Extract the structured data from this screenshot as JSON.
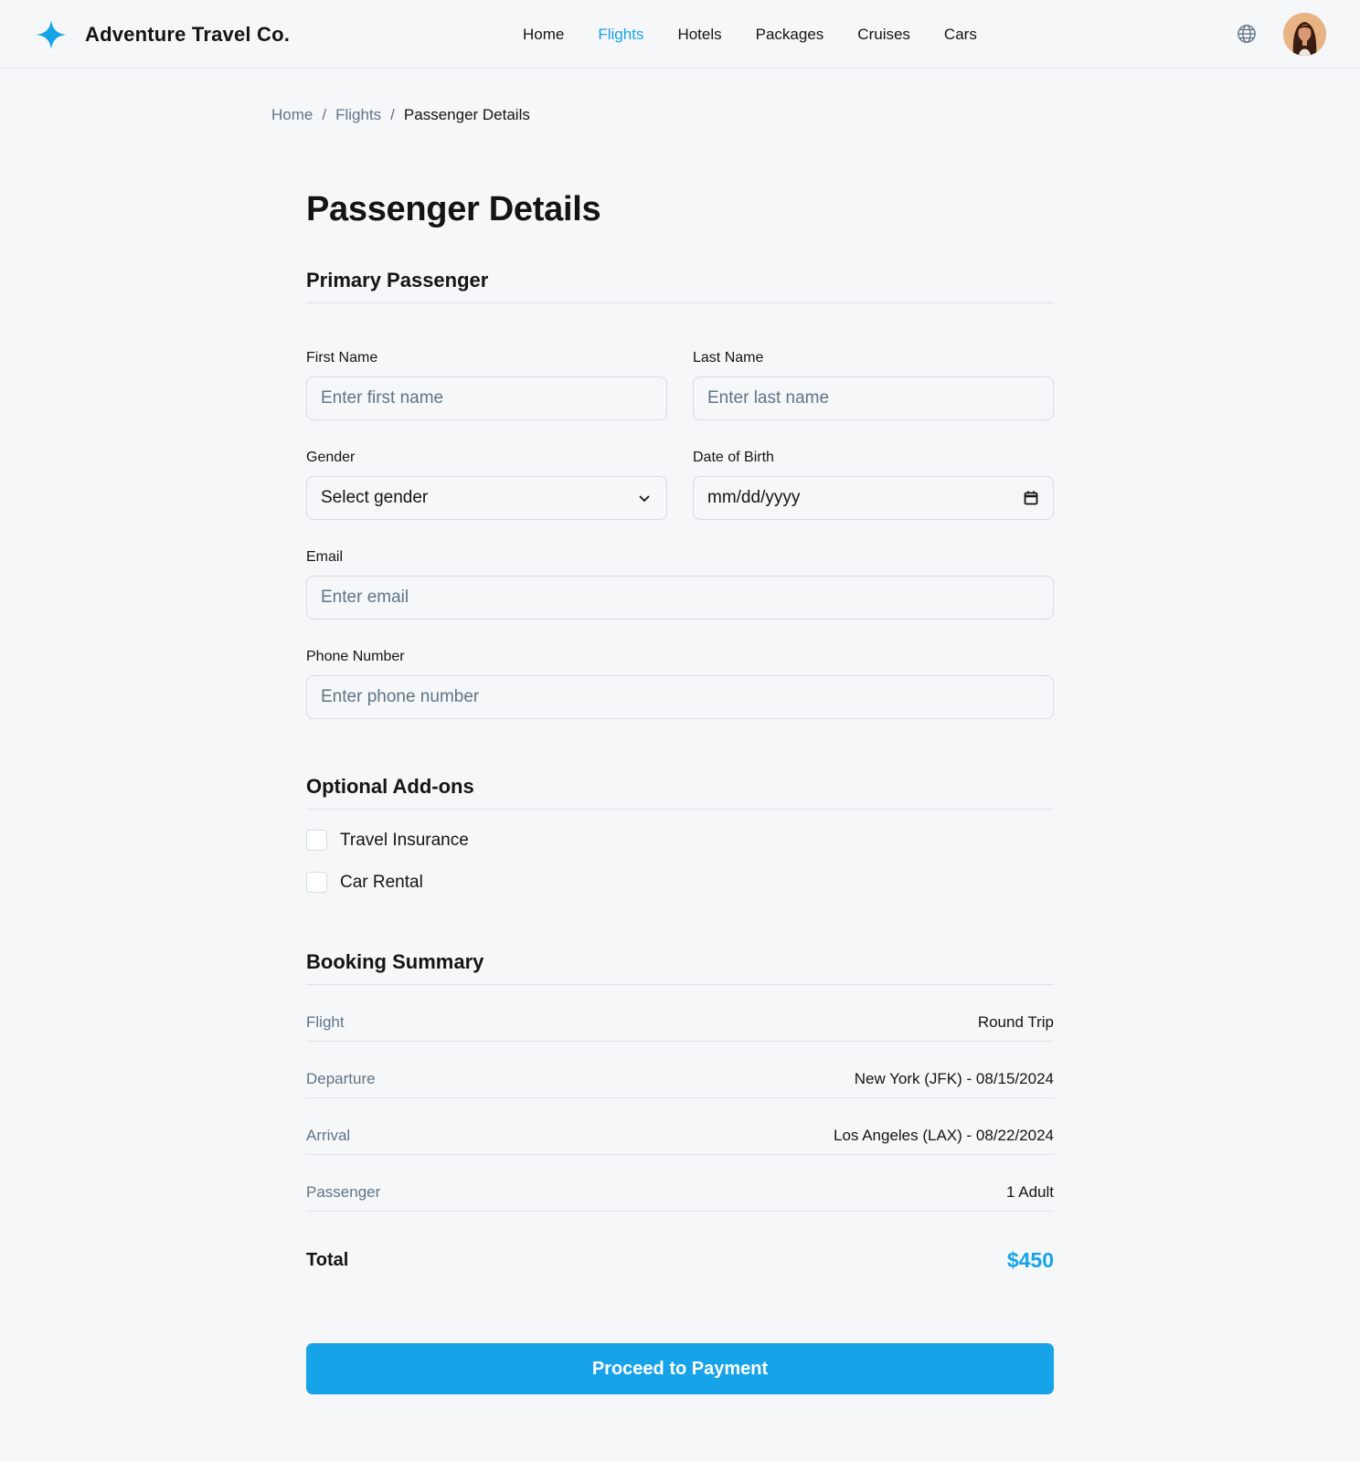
{
  "header": {
    "brand": "Adventure Travel Co.",
    "nav": [
      {
        "label": "Home"
      },
      {
        "label": "Flights"
      },
      {
        "label": "Hotels"
      },
      {
        "label": "Packages"
      },
      {
        "label": "Cruises"
      },
      {
        "label": "Cars"
      }
    ],
    "active_nav": "Flights",
    "icons": [
      "sparkle-logo-icon",
      "globe-icon",
      "user-avatar"
    ]
  },
  "breadcrumb": [
    "Home",
    "Flights",
    "Passenger Details"
  ],
  "page_title": "Passenger Details",
  "primary_passenger": {
    "title": "Primary Passenger",
    "first_name": {
      "label": "First Name",
      "placeholder": "Enter first name",
      "value": ""
    },
    "last_name": {
      "label": "Last Name",
      "placeholder": "Enter last name",
      "value": ""
    },
    "gender": {
      "label": "Gender",
      "selected": "Select gender"
    },
    "dob": {
      "label": "Date of Birth",
      "placeholder": "mm/dd/yyyy"
    },
    "email": {
      "label": "Email",
      "placeholder": "Enter email",
      "value": ""
    },
    "phone": {
      "label": "Phone Number",
      "placeholder": "Enter phone number",
      "value": ""
    }
  },
  "addons": {
    "title": "Optional Add-ons",
    "items": [
      {
        "label": "Travel Insurance",
        "checked": false
      },
      {
        "label": "Car Rental",
        "checked": false
      }
    ]
  },
  "summary": {
    "title": "Booking Summary",
    "rows": [
      {
        "key": "Flight",
        "value": "Round Trip"
      },
      {
        "key": "Departure",
        "value": "New York (JFK) - 08/15/2024"
      },
      {
        "key": "Arrival",
        "value": "Los Angeles (LAX) - 08/22/2024"
      },
      {
        "key": "Passenger",
        "value": "1 Adult"
      }
    ],
    "total_label": "Total",
    "total_value": "$450"
  },
  "cta": "Proceed to Payment",
  "colors": {
    "accent": "#17a3e8",
    "background": "#f6f7f9",
    "text": "#121416",
    "muted": "#5f7586"
  }
}
